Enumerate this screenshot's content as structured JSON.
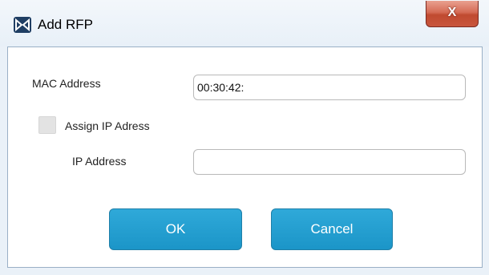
{
  "window": {
    "title": "Add RFP",
    "close_glyph": "X",
    "app_icon": "dect-logo-icon"
  },
  "form": {
    "mac_label": "MAC Address",
    "mac_value": "00:30:42:",
    "assign_ip_label": "Assign IP Adress",
    "assign_ip_checked": false,
    "ip_label": "IP Address",
    "ip_value": ""
  },
  "buttons": {
    "ok_label": "OK",
    "cancel_label": "Cancel"
  },
  "colors": {
    "button_blue": "#23a0d3",
    "close_red": "#c8563d",
    "title_bg": "#eaf1f8"
  }
}
